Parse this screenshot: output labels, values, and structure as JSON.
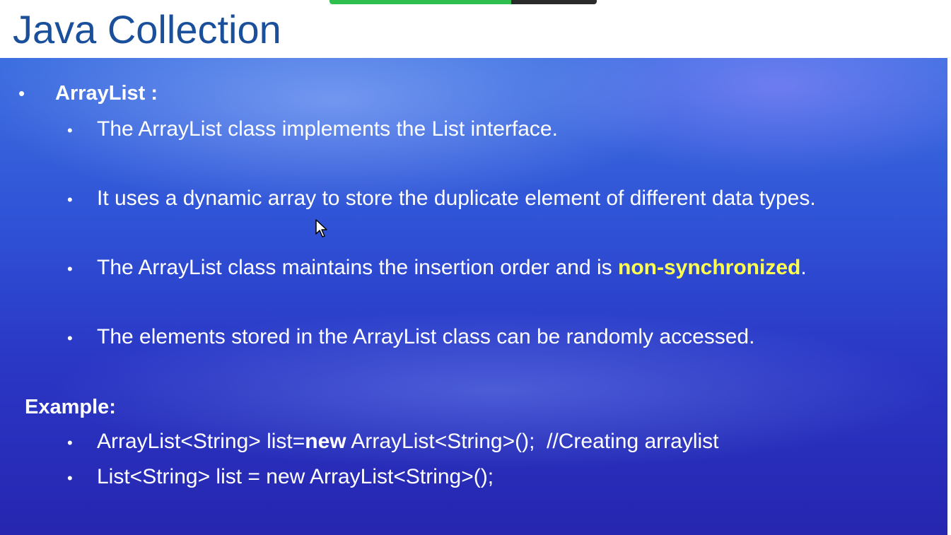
{
  "slide": {
    "title": "Java Collection",
    "main_bullet": "ArrayList :",
    "points": [
      "The ArrayList class implements the List interface.",
      "It uses a dynamic array to store the duplicate element of different data types.",
      "The ArrayList class maintains the insertion order and is ",
      "The elements stored in the ArrayList class can be randomly accessed."
    ],
    "highlight_text": "non-synchronized",
    "highlight_suffix": ".",
    "example_heading": "Example:",
    "code_lines": {
      "line1_before": "ArrayList<String> list=",
      "line1_keyword": "new",
      "line1_after": " ArrayList<String>();  //Creating arraylist",
      "line2": "List<String> list = new ArrayList<String>();"
    },
    "bullet_glyph": "•"
  },
  "colors": {
    "title": "#1a4f9b",
    "background_top": "#3d6fe0",
    "background_bottom": "#2626b0",
    "text": "#ffffff",
    "highlight": "#ffff4d",
    "share_bar_green": "#2fbf4f"
  },
  "icons": {
    "cursor": "mouse-pointer-icon",
    "bullet": "bullet-dot"
  }
}
